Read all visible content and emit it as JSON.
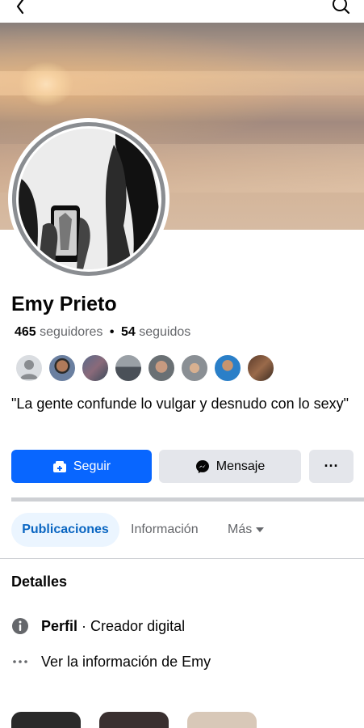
{
  "profile": {
    "name": "Emy Prieto",
    "followers_count": "465",
    "followers_label": "seguidores",
    "following_count": "54",
    "following_label": "seguidos",
    "separator": "•",
    "bio": "\"La gente confunde lo vulgar y desnudo  con lo sexy\""
  },
  "actions": {
    "follow_label": "Seguir",
    "message_label": "Mensaje",
    "more_label": "···"
  },
  "tabs": [
    {
      "label": "Publicaciones",
      "active": true
    },
    {
      "label": "Información",
      "active": false
    },
    {
      "label": "Más",
      "active": false
    }
  ],
  "details": {
    "title": "Detalles",
    "profile_label": "Perfil",
    "profile_sep": " · ",
    "profile_value": "Creador digital",
    "see_info_label": "Ver la información de Emy"
  },
  "icons": {
    "back": "chevron-left-icon",
    "search": "search-icon",
    "follow": "add-user-icon",
    "message": "messenger-icon",
    "info": "info-icon",
    "dots": "more-dots-icon",
    "caret": "caret-down-icon"
  },
  "colors": {
    "primary": "#0866ff",
    "secondary_button": "#e4e6eb",
    "active_tab_bg": "#ebf5ff",
    "active_tab_text": "#0a66c2",
    "muted_text": "#65676b"
  }
}
